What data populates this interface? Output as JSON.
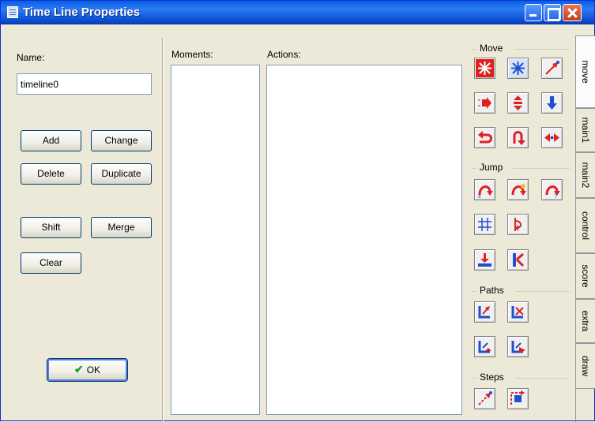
{
  "window": {
    "title": "Time Line Properties"
  },
  "left": {
    "name_label": "Name:",
    "name_value": "timeline0",
    "buttons": {
      "add": "Add",
      "change": "Change",
      "delete": "Delete",
      "duplicate": "Duplicate",
      "shift": "Shift",
      "merge": "Merge",
      "clear": "Clear",
      "ok": "OK"
    }
  },
  "lists": {
    "moments_label": "Moments:",
    "actions_label": "Actions:"
  },
  "palette": {
    "groups": {
      "move": "Move",
      "jump": "Jump",
      "paths": "Paths",
      "steps": "Steps"
    },
    "icons": {
      "move": [
        "fixed-move-icon",
        "free-move-icon",
        "move-towards-icon",
        "speed-horizontal-icon",
        "speed-vertical-icon",
        "gravity-icon",
        "reverse-horizontal-icon",
        "reverse-vertical-icon",
        "friction-icon"
      ],
      "jump": [
        "jump-to-position-icon",
        "jump-to-start-icon",
        "jump-to-random-icon",
        "snap-to-grid-icon",
        "wrap-screen-icon",
        "move-to-contact-icon",
        "bounce-icon"
      ],
      "paths": [
        "set-path-icon",
        "end-path-icon",
        "path-position-icon",
        "path-speed-icon"
      ],
      "steps": [
        "step-towards-icon",
        "step-avoiding-icon"
      ]
    }
  },
  "tabs": [
    "move",
    "main1",
    "main2",
    "control",
    "score",
    "extra",
    "draw"
  ],
  "colors": {
    "titlebar": "#0a5fe0",
    "icon_red": "#e02020",
    "icon_blue": "#1f4fd0"
  }
}
